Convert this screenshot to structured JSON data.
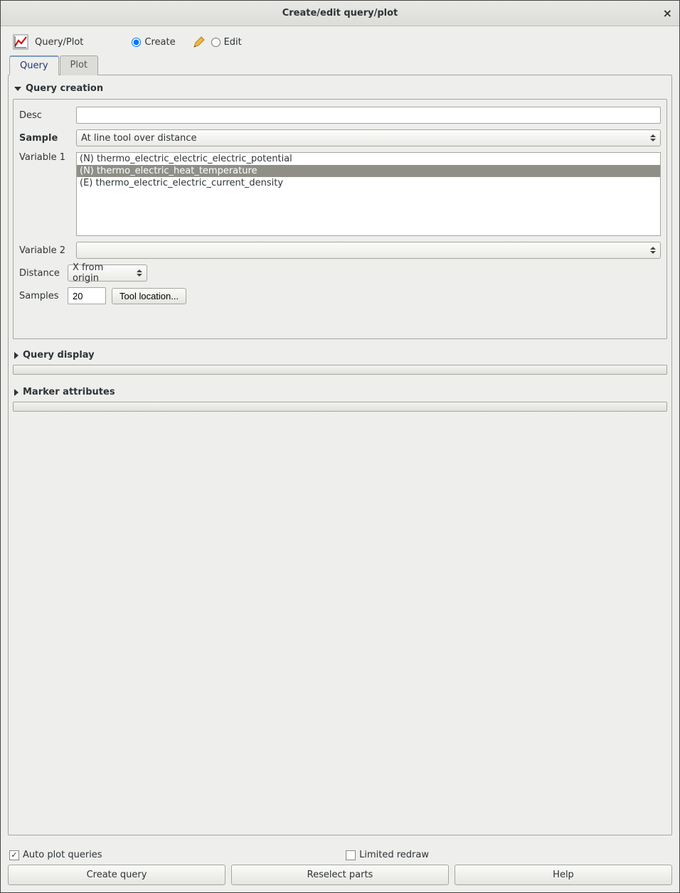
{
  "window": {
    "title": "Create/edit query/plot"
  },
  "toolbar": {
    "label": "Query/Plot",
    "create": "Create",
    "edit": "Edit"
  },
  "tabs": {
    "query": "Query",
    "plot": "Plot"
  },
  "sections": {
    "creation": "Query creation",
    "display": "Query display",
    "marker": "Marker attributes"
  },
  "form": {
    "desc_label": "Desc",
    "desc_value": "",
    "sample_label": "Sample",
    "sample_value": "At line tool over distance",
    "var1_label": "Variable 1",
    "var1_items": [
      "(N) thermo_electric_electric_electric_potential",
      "(N) thermo_electric_heat_temperature",
      "(E) thermo_electric_electric_current_density"
    ],
    "var1_selected_index": 1,
    "var2_label": "Variable 2",
    "var2_value": "",
    "distance_label": "Distance",
    "distance_value": "X from origin",
    "samples_label": "Samples",
    "samples_value": "20",
    "tool_location_btn": "Tool location..."
  },
  "bottom": {
    "auto_plot": "Auto plot queries",
    "limited_redraw": "Limited redraw",
    "create_query": "Create query",
    "reselect_parts": "Reselect parts",
    "help": "Help"
  }
}
